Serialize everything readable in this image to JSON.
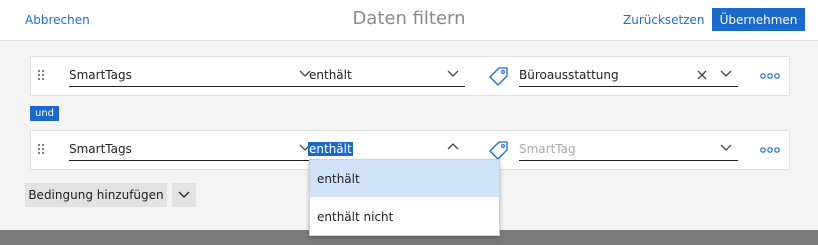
{
  "header": {
    "cancel_label": "Abbrechen",
    "title": "Daten filtern",
    "reset_label": "Zurücksetzen",
    "apply_label": "Übernehmen"
  },
  "conditions": [
    {
      "field": "SmartTags",
      "operator": "enthält",
      "value": "Büroausstattung",
      "value_placeholder": ""
    },
    {
      "field": "SmartTags",
      "operator": "enthält",
      "value": "",
      "value_placeholder": "SmartTag"
    }
  ],
  "connector_label": "und",
  "operator_options": [
    "enthält",
    "enthält nicht"
  ],
  "add_condition_label": "Bedingung hinzufügen",
  "colors": {
    "accent": "#1b6ac9",
    "option_hover": "#cfe2f6"
  }
}
